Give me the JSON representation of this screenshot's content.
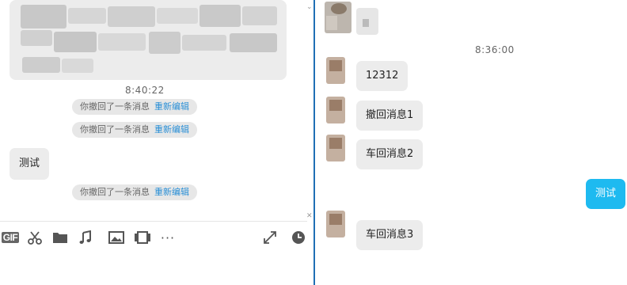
{
  "left": {
    "timestamp": "8:40:22",
    "recall_notices": [
      {
        "text": "你撤回了一条消息",
        "action": "重新编辑"
      },
      {
        "text": "你撤回了一条消息",
        "action": "重新编辑"
      },
      {
        "text": "你撤回了一条消息",
        "action": "重新编辑"
      }
    ],
    "incoming_message": "测试",
    "toolbar": {
      "gif_label": "GIF",
      "more_label": "···",
      "icons": [
        "gif-icon",
        "scissors-icon",
        "folder-icon",
        "music-icon",
        "image-icon",
        "video-icon",
        "more-icon",
        "expand-icon",
        "clock-icon"
      ]
    }
  },
  "right": {
    "timestamp": "8:36:00",
    "messages": [
      {
        "side": "incoming",
        "text": "12312"
      },
      {
        "side": "incoming",
        "text": "撤回消息1"
      },
      {
        "side": "incoming",
        "text": "车回消息2"
      },
      {
        "side": "outgoing",
        "text": "测试"
      },
      {
        "side": "incoming",
        "text": "车回消息3"
      }
    ]
  },
  "colors": {
    "divider": "#1f6fb5",
    "link": "#2a8fd6",
    "outgoing_bubble": "#1ebaf0",
    "incoming_bubble": "#ececec",
    "pill": "#e7e7e7"
  }
}
